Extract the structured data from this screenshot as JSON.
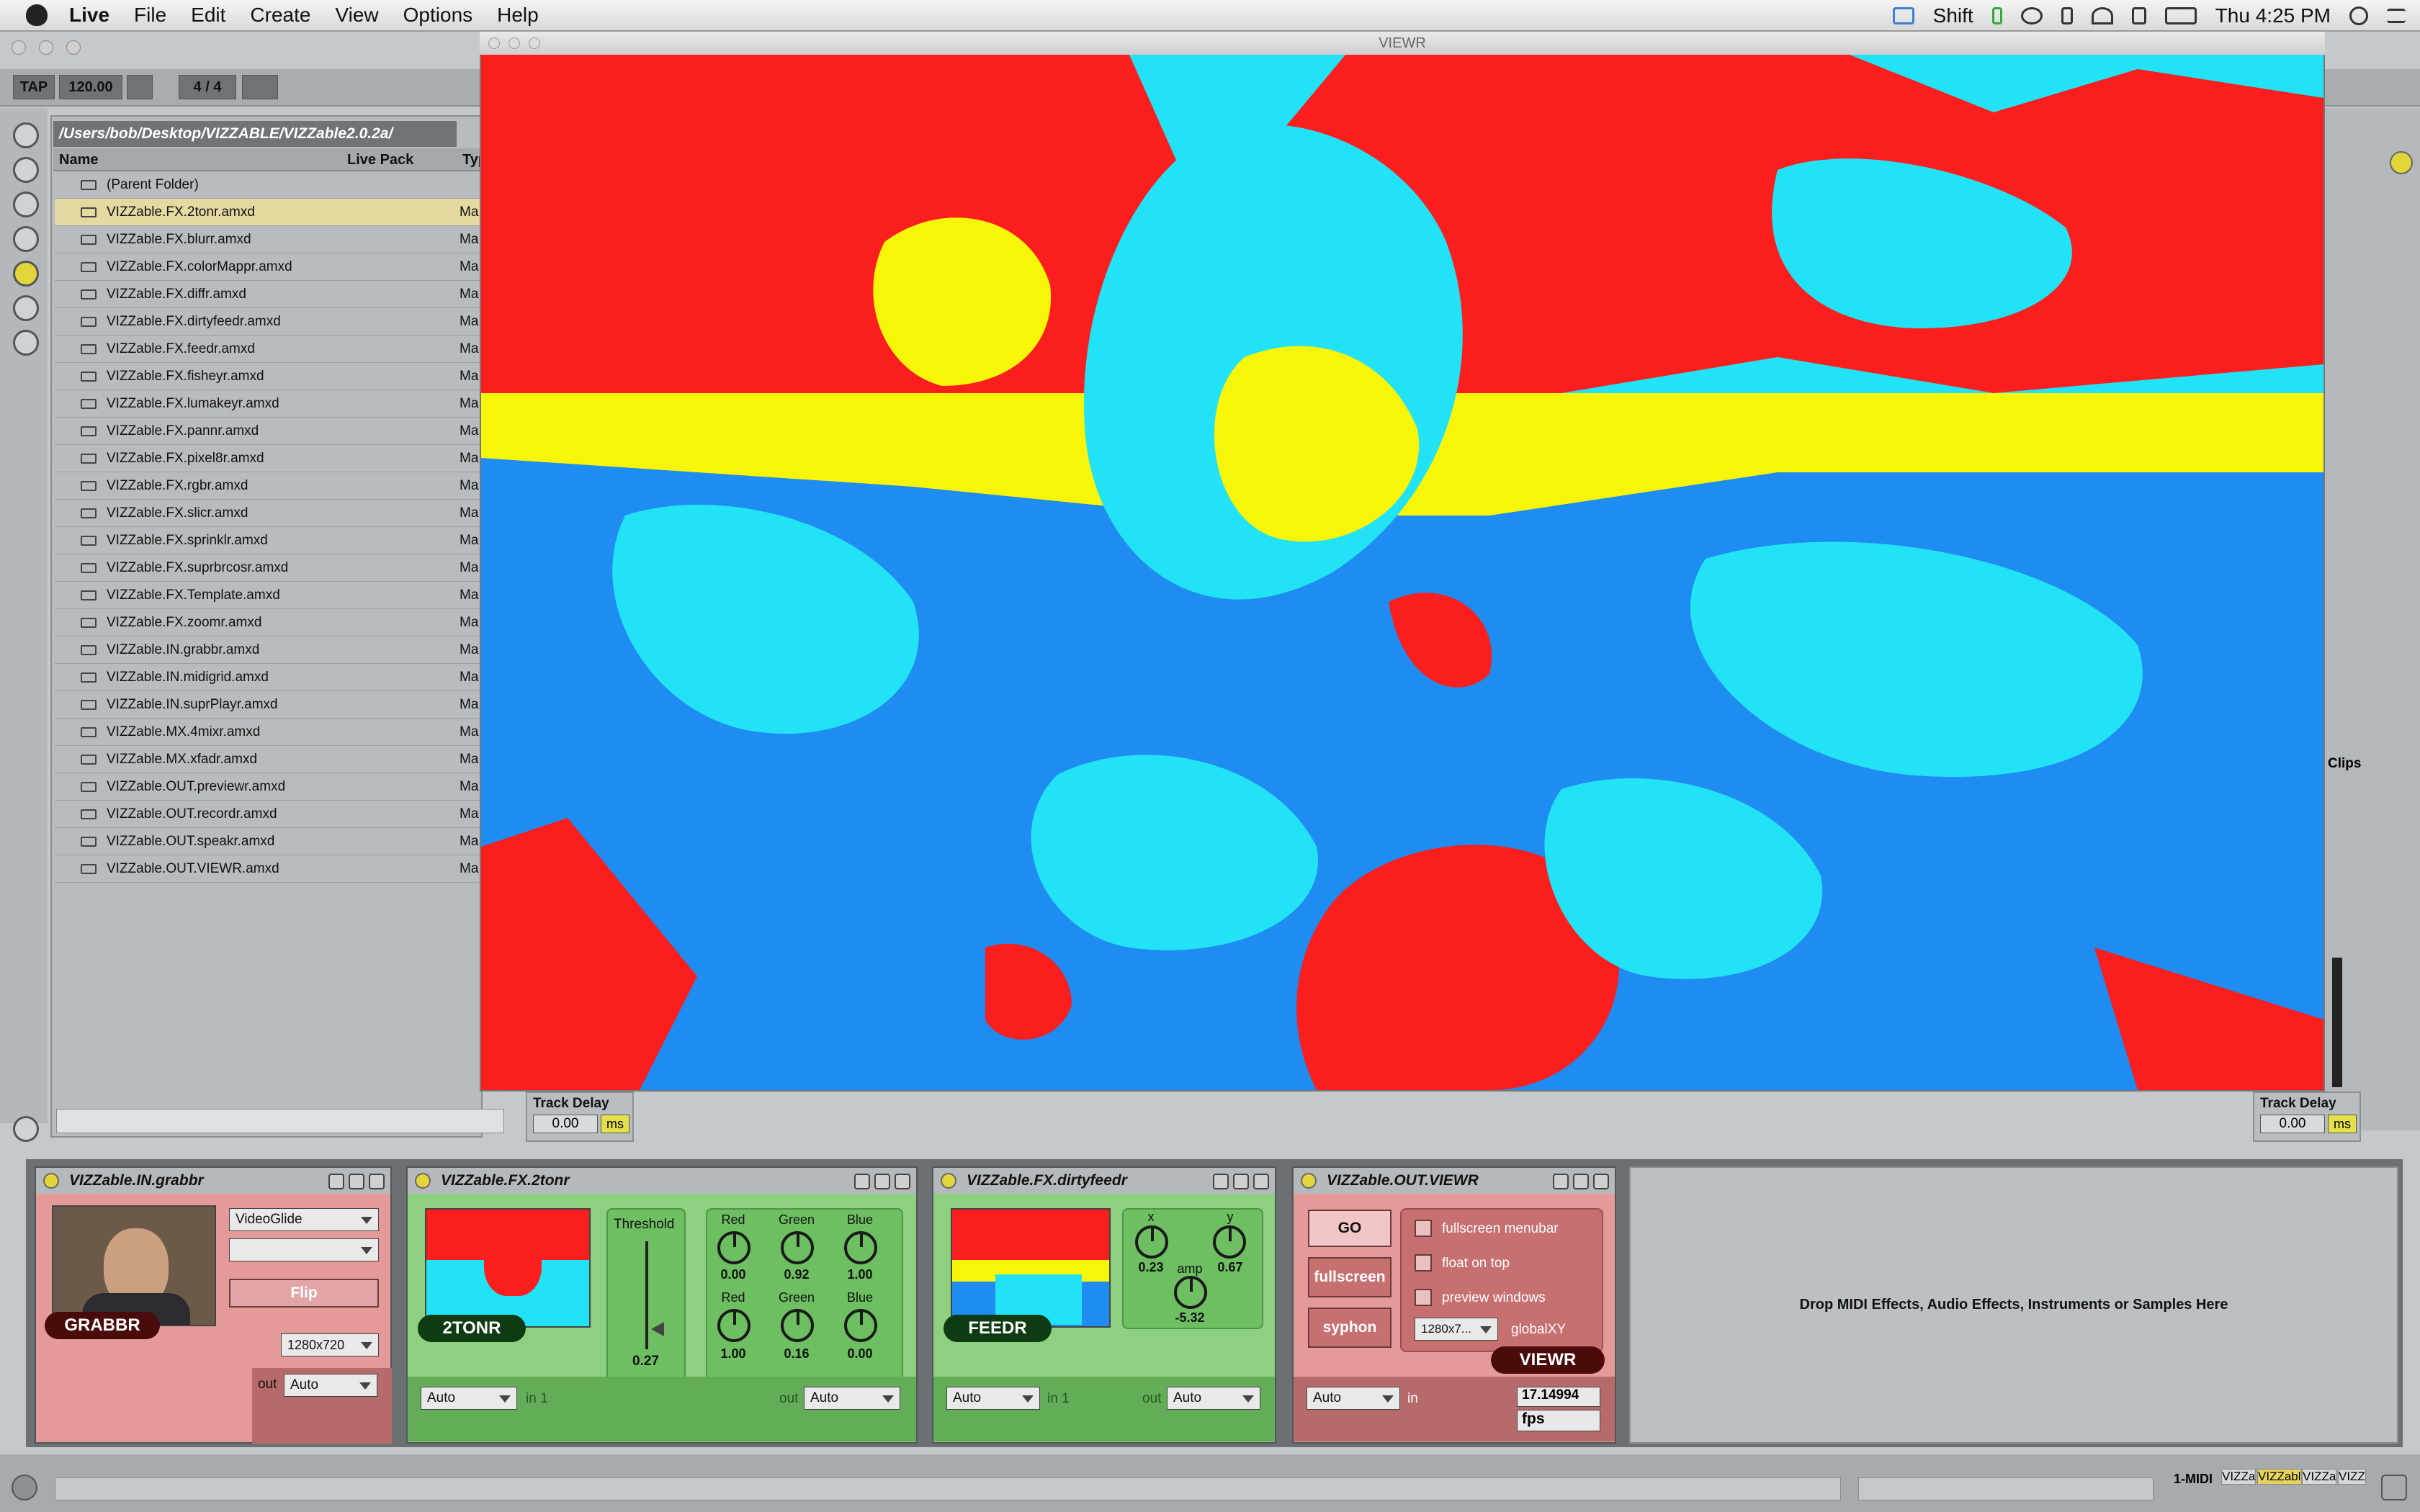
{
  "menubar": {
    "app": "Live",
    "items": [
      "File",
      "Edit",
      "Create",
      "View",
      "Options",
      "Help"
    ],
    "user": "Shift",
    "clock": "Thu 4:25 PM"
  },
  "transport": {
    "tap": "TAP",
    "bpm": "120.00",
    "sig": "4 / 4"
  },
  "browser": {
    "path": "/Users/bob/Desktop/VIZZABLE/VIZZable2.0.2a/",
    "columns": {
      "name": "Name",
      "pack": "Live Pack",
      "type": "Typ"
    },
    "parent": "(Parent Folder)",
    "type_abbrev": "Ma",
    "files": [
      "VIZZable.FX.2tonr.amxd",
      "VIZZable.FX.blurr.amxd",
      "VIZZable.FX.colorMappr.amxd",
      "VIZZable.FX.diffr.amxd",
      "VIZZable.FX.dirtyfeedr.amxd",
      "VIZZable.FX.feedr.amxd",
      "VIZZable.FX.fisheyr.amxd",
      "VIZZable.FX.lumakeyr.amxd",
      "VIZZable.FX.pannr.amxd",
      "VIZZable.FX.pixel8r.amxd",
      "VIZZable.FX.rgbr.amxd",
      "VIZZable.FX.slicr.amxd",
      "VIZZable.FX.sprinklr.amxd",
      "VIZZable.FX.suprbrcosr.amxd",
      "VIZZable.FX.Template.amxd",
      "VIZZable.FX.zoomr.amxd",
      "VIZZable.IN.grabbr.amxd",
      "VIZZable.IN.midigrid.amxd",
      "VIZZable.IN.suprPlayr.amxd",
      "VIZZable.MX.4mixr.amxd",
      "VIZZable.MX.xfadr.amxd",
      "VIZZable.OUT.previewr.amxd",
      "VIZZable.OUT.recordr.amxd",
      "VIZZable.OUT.speakr.amxd",
      "VIZZable.OUT.VIEWR.amxd"
    ]
  },
  "viewr": {
    "title": "VIEWR"
  },
  "track_delay": {
    "label": "Track Delay",
    "value": "0.00",
    "unit": "ms"
  },
  "right_panel": {
    "clips": "Clips"
  },
  "devices": {
    "grabbr": {
      "title": "VIZZable.IN.grabbr",
      "source": "VideoGlide",
      "flip": "Flip",
      "resolution": "1280x720",
      "badge": "GRABBR",
      "out_label": "out",
      "out_value": "Auto"
    },
    "tonr": {
      "title": "VIZZable.FX.2tonr",
      "badge": "2TONR",
      "threshold_label": "Threshold",
      "threshold_value": "0.27",
      "labels": {
        "red": "Red",
        "green": "Green",
        "blue": "Blue"
      },
      "row1": {
        "red": "0.00",
        "green": "0.92",
        "blue": "1.00"
      },
      "row2": {
        "red": "1.00",
        "green": "0.16",
        "blue": "0.00"
      },
      "in_value": "Auto",
      "in_label": "in 1",
      "out_label": "out",
      "out_value": "Auto"
    },
    "feedr": {
      "title": "VIZZable.FX.dirtyfeedr",
      "badge": "FEEDR",
      "x_label": "x",
      "x_value": "0.23",
      "y_label": "y",
      "y_value": "0.67",
      "amp_label": "amp",
      "amp_value": "-5.32",
      "in_value": "Auto",
      "in_label": "in 1",
      "out_label": "out",
      "out_value": "Auto"
    },
    "viewr": {
      "title": "VIZZable.OUT.VIEWR",
      "go": "GO",
      "fullscreen": "fullscreen",
      "syphon": "syphon",
      "opt1": "fullscreen menubar",
      "opt2": "float on top",
      "opt3": "preview windows",
      "res": "1280x7...",
      "global": "globalXY",
      "badge": "VIEWR",
      "fps_value": "17.14994",
      "fps_label": "fps",
      "in_value": "Auto",
      "in_label": "in"
    }
  },
  "dropzone": "Drop MIDI Effects, Audio Effects, Instruments or Samples Here",
  "statusbar": {
    "track": "1-MIDI",
    "clips": [
      "VIZZa",
      "VIZZabl",
      "VIZZa",
      "VIZZ"
    ]
  }
}
